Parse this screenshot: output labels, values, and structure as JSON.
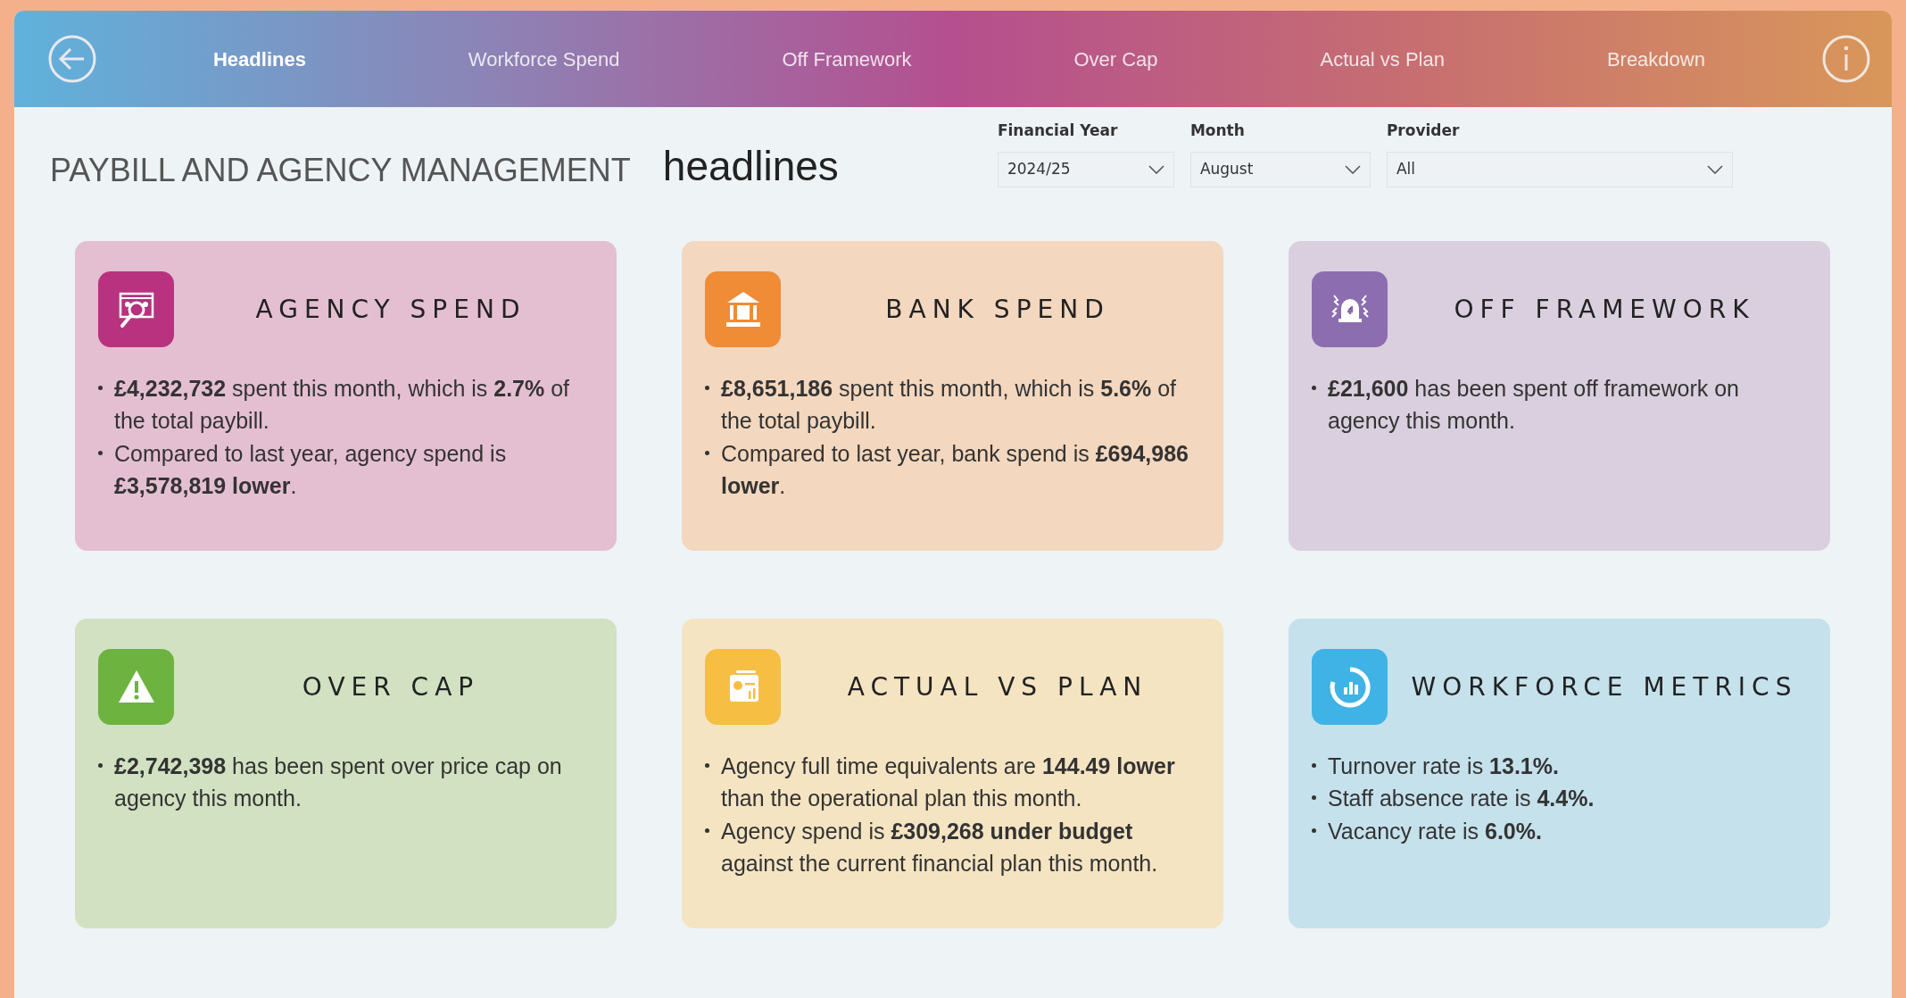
{
  "nav": {
    "tabs": [
      {
        "label": "Headlines",
        "selected": true
      },
      {
        "label": "Workforce Spend",
        "selected": false
      },
      {
        "label": "Off Framework",
        "selected": false
      },
      {
        "label": "Over Cap",
        "selected": false
      },
      {
        "label": "Actual vs Plan",
        "selected": false
      },
      {
        "label": "Breakdown",
        "selected": false
      }
    ]
  },
  "title": "PAYBILL AND AGENCY MANAGEMENT",
  "subtitle": "headlines",
  "filters": [
    {
      "label": "Financial Year",
      "value": "2024/25"
    },
    {
      "label": "Month",
      "value": "August"
    },
    {
      "label": "Provider",
      "value": "All"
    }
  ],
  "cards": [
    {
      "title": "AGENCY SPEND",
      "color": "#b83280",
      "bullets": [
        "**£4,232,732** spent this month, which is **2.7%** of the total paybill.",
        "Compared to last year, agency spend is **£3,578,819 lower**."
      ]
    },
    {
      "title": "BANK SPEND",
      "color": "#ef8c35",
      "bullets": [
        "**£8,651,186** spent this month, which is **5.6%** of the total paybill.",
        "Compared to last year, bank spend is **£694,986 lower**."
      ]
    },
    {
      "title": "OFF FRAMEWORK",
      "color": "#8c6db0",
      "bullets": [
        "**£21,600** has been spent off framework on agency this month."
      ]
    },
    {
      "title": "OVER CAP",
      "color": "#6db33f",
      "bullets": [
        "**£2,742,398** has been spent over price cap on agency this month."
      ]
    },
    {
      "title": "ACTUAL VS PLAN",
      "color": "#f6bf44",
      "bullets": [
        "Agency full time equivalents are **144.49 lower** than the operational plan this month.",
        "Agency spend is **£309,268 under budget** against the current financial plan this month."
      ]
    },
    {
      "title": "WORKFORCE METRICS",
      "color": "#3fb3e6",
      "bullets": [
        "Turnover rate is **13.1%.**",
        "Staff absence rate is **4.4%.**",
        "Vacancy rate is **6.0%.**"
      ]
    }
  ]
}
